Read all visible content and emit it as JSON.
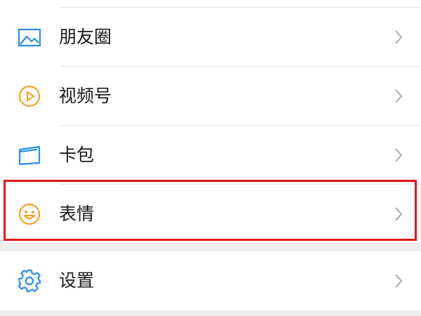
{
  "menu": {
    "items": [
      {
        "label": "朋友圈",
        "icon": "moments-icon",
        "color": "#2c8cf4"
      },
      {
        "label": "视频号",
        "icon": "channels-icon",
        "color": "#f4a02a"
      },
      {
        "label": "卡包",
        "icon": "cards-icon",
        "color": "#2c8cf4"
      },
      {
        "label": "表情",
        "icon": "stickers-icon",
        "color": "#f4a02a",
        "highlighted": true
      }
    ],
    "settings": {
      "label": "设置",
      "icon": "settings-icon",
      "color": "#2c8cf4"
    }
  },
  "highlight_color": "#e8141b"
}
